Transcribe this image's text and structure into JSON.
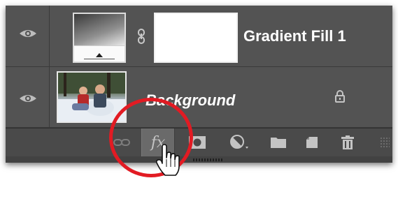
{
  "layers_panel": {
    "layers": [
      {
        "name": "Gradient Fill 1",
        "visibility_icon": "eye-icon",
        "thumbnail": "gradient-fill-thumbnail",
        "mask": "white-mask-thumbnail",
        "link_icon": "chain-link-icon"
      },
      {
        "name": "Background",
        "visibility_icon": "eye-icon",
        "thumbnail": "photo-thumbnail",
        "lock_icon": "lock-icon"
      }
    ],
    "toolbar": {
      "buttons": [
        {
          "name": "link-layers",
          "icon": "link-icon"
        },
        {
          "name": "add-layer-style",
          "label": "fx",
          "icon": "fx-icon",
          "highlighted": true
        },
        {
          "name": "add-layer-mask",
          "icon": "mask-icon"
        },
        {
          "name": "new-adjustment-layer",
          "icon": "half-circle-icon"
        },
        {
          "name": "new-group",
          "icon": "folder-icon"
        },
        {
          "name": "new-layer",
          "icon": "new-layer-icon"
        },
        {
          "name": "delete-layer",
          "icon": "trash-icon"
        }
      ]
    }
  },
  "annotation": {
    "highlight_color": "#e21b23",
    "cursor": "hand-pointer-icon"
  },
  "colors": {
    "panel_bg": "#535353",
    "toolbar_bg": "#4a4a4a",
    "text": "#ffffff",
    "icon": "#c4c4c4"
  }
}
